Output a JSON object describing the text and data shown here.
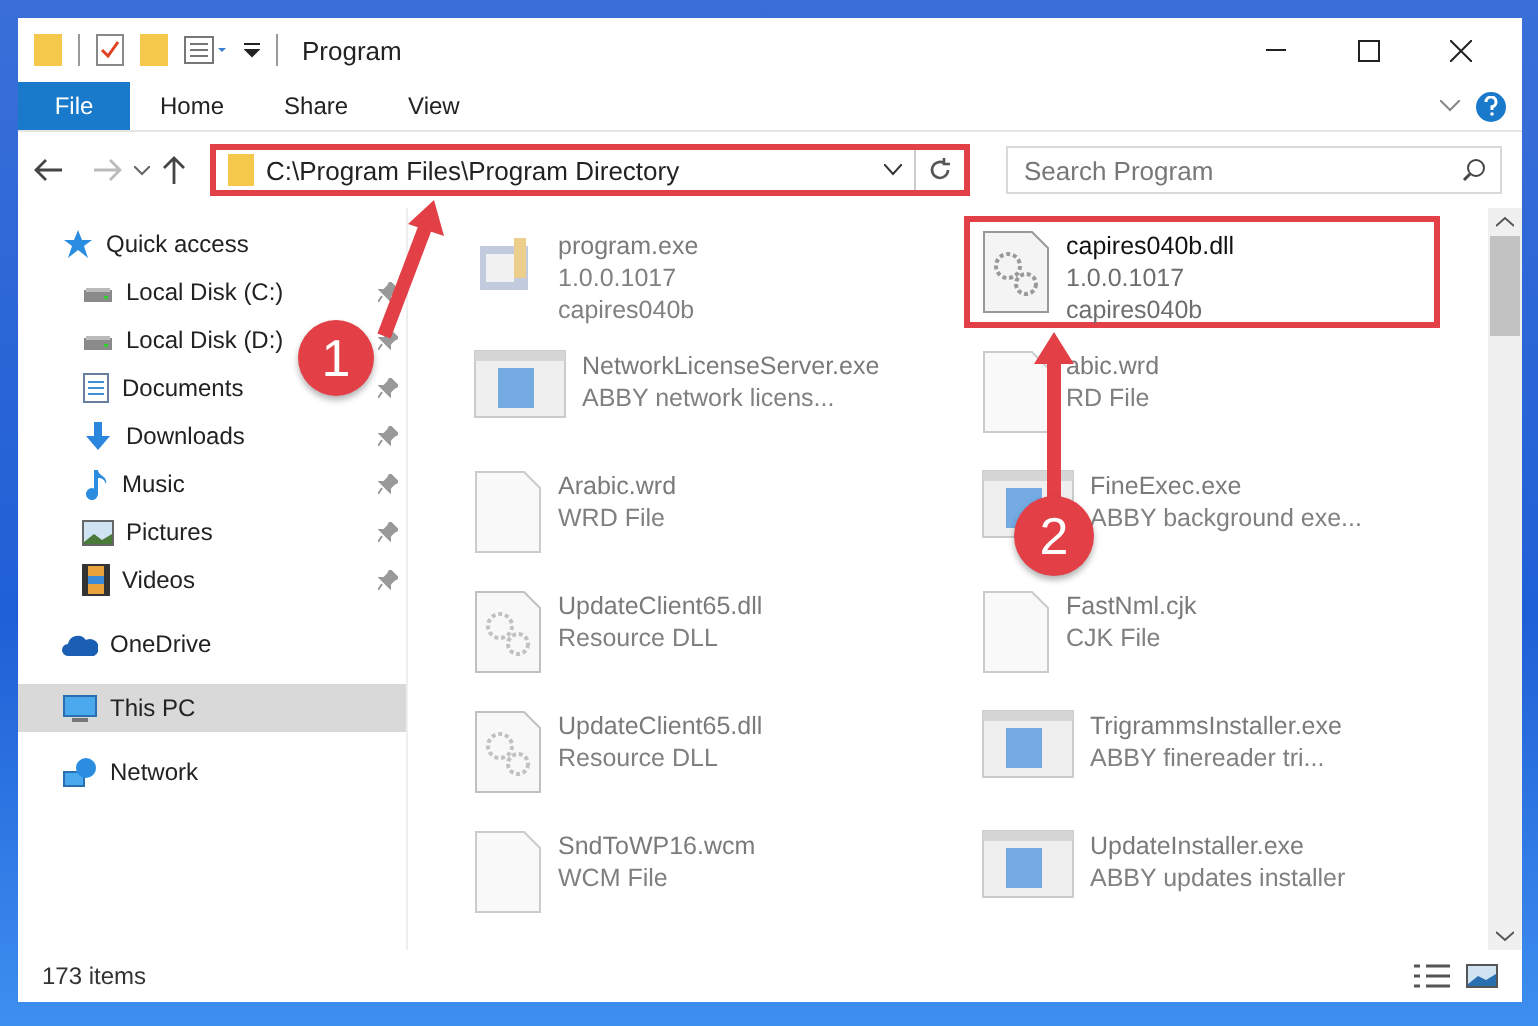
{
  "window": {
    "title": "Program"
  },
  "ribbon_tabs": [
    {
      "label": "File",
      "selected": true
    },
    {
      "label": "Home",
      "selected": false
    },
    {
      "label": "Share",
      "selected": false
    },
    {
      "label": "View",
      "selected": false
    }
  ],
  "address_bar": {
    "path": "C:\\Program Files\\Program Directory",
    "highlighted": true
  },
  "search": {
    "placeholder": "Search Program"
  },
  "sidebar": {
    "items": [
      {
        "label": "Quick access",
        "pinned": false,
        "selected": false,
        "children": [
          {
            "label": "Local Disk (C:)",
            "pinned": true,
            "selected": false
          },
          {
            "label": "Local Disk (D:)",
            "pinned": true,
            "selected": false
          },
          {
            "label": "Documents",
            "pinned": true,
            "selected": false
          },
          {
            "label": "Downloads",
            "pinned": true,
            "selected": false
          },
          {
            "label": "Music",
            "pinned": true,
            "selected": false
          },
          {
            "label": "Pictures",
            "pinned": true,
            "selected": false
          },
          {
            "label": "Videos",
            "pinned": true,
            "selected": false
          }
        ]
      },
      {
        "label": "OneDrive",
        "pinned": false,
        "selected": false
      },
      {
        "label": "This PC",
        "pinned": false,
        "selected": true
      },
      {
        "label": "Network",
        "pinned": false,
        "selected": false
      }
    ]
  },
  "files": [
    {
      "name": "program.exe",
      "lines": [
        "1.0.0.1017",
        "capires040b"
      ],
      "kind": "installer",
      "dimmed": true,
      "highlighted": false
    },
    {
      "name": "capires040b.dll",
      "lines": [
        "1.0.0.1017",
        "capires040b"
      ],
      "kind": "dll",
      "dimmed": false,
      "highlighted": true
    },
    {
      "name": "NetworkLicenseServer.exe",
      "lines": [
        "ABBY network licens..."
      ],
      "kind": "app",
      "dimmed": true,
      "highlighted": false
    },
    {
      "name": "abic.wrd",
      "lines": [
        "RD File"
      ],
      "kind": "file",
      "dimmed": true,
      "highlighted": false
    },
    {
      "name": "Arabic.wrd",
      "lines": [
        "WRD File"
      ],
      "kind": "file",
      "dimmed": true,
      "highlighted": false
    },
    {
      "name": "FineExec.exe",
      "lines": [
        "ABBY background exe..."
      ],
      "kind": "app",
      "dimmed": true,
      "highlighted": false
    },
    {
      "name": "UpdateClient65.dll",
      "lines": [
        "Resource DLL"
      ],
      "kind": "dll",
      "dimmed": true,
      "highlighted": false
    },
    {
      "name": "FastNml.cjk",
      "lines": [
        "CJK File"
      ],
      "kind": "file",
      "dimmed": true,
      "highlighted": false
    },
    {
      "name": "UpdateClient65.dll",
      "lines": [
        "Resource DLL"
      ],
      "kind": "dll",
      "dimmed": true,
      "highlighted": false
    },
    {
      "name": "TrigrammsInstaller.exe",
      "lines": [
        "ABBY finereader tri..."
      ],
      "kind": "app",
      "dimmed": true,
      "highlighted": false
    },
    {
      "name": "SndToWP16.wcm",
      "lines": [
        "WCM File"
      ],
      "kind": "file",
      "dimmed": true,
      "highlighted": false
    },
    {
      "name": "UpdateInstaller.exe",
      "lines": [
        "ABBY updates installer"
      ],
      "kind": "app",
      "dimmed": true,
      "highlighted": false
    }
  ],
  "status_bar": {
    "count": "173 items"
  },
  "annotations": [
    {
      "label": "1"
    },
    {
      "label": "2"
    }
  ]
}
